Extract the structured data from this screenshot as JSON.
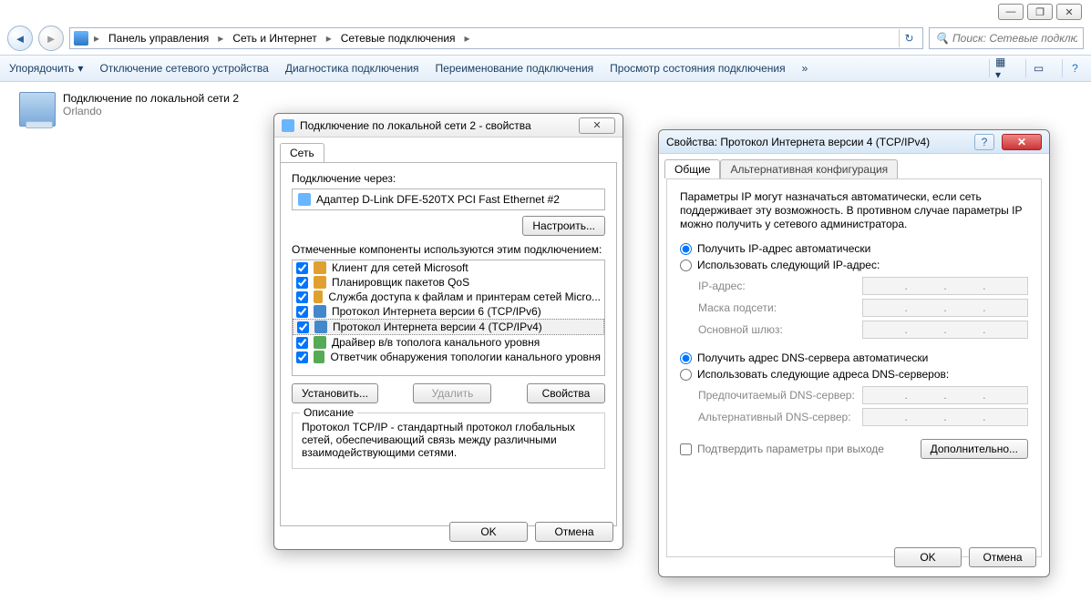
{
  "window": {
    "min_icon": "—",
    "max_icon": "❐",
    "close_icon": "✕"
  },
  "breadcrumb": {
    "items": [
      "Панель управления",
      "Сеть и Интернет",
      "Сетевые подключения"
    ],
    "search_placeholder": "Поиск: Сетевые подключ..."
  },
  "toolbar": {
    "organize": "Упорядочить",
    "disable": "Отключение сетевого устройства",
    "diagnose": "Диагностика подключения",
    "rename": "Переименование подключения",
    "status": "Просмотр состояния подключения"
  },
  "connection": {
    "name": "Подключение по локальной сети 2",
    "sub": "Orlando"
  },
  "dlg1": {
    "title": "Подключение по локальной сети 2 - свойства",
    "tab": "Сеть",
    "connect_via": "Подключение через:",
    "adapter": "Адаптер D-Link DFE-520TX PCI Fast Ethernet #2",
    "configure": "Настроить...",
    "components_label": "Отмеченные компоненты используются этим подключением:",
    "components": [
      "Клиент для сетей Microsoft",
      "Планировщик пакетов QoS",
      "Служба доступа к файлам и принтерам сетей Micro...",
      "Протокол Интернета версии 6 (TCP/IPv6)",
      "Протокол Интернета версии 4 (TCP/IPv4)",
      "Драйвер в/в тополога канального уровня",
      "Ответчик обнаружения топологии канального уровня"
    ],
    "install": "Установить...",
    "uninstall": "Удалить",
    "properties": "Свойства",
    "desc_title": "Описание",
    "desc_text": "Протокол TCP/IP - стандартный протокол глобальных сетей, обеспечивающий связь между различными взаимодействующими сетями.",
    "ok": "OK",
    "cancel": "Отмена"
  },
  "dlg2": {
    "title": "Свойства: Протокол Интернета версии 4 (TCP/IPv4)",
    "tab_general": "Общие",
    "tab_alt": "Альтернативная конфигурация",
    "intro": "Параметры IP могут назначаться автоматически, если сеть поддерживает эту возможность. В противном случае параметры IP можно получить у сетевого администратора.",
    "radio_auto_ip": "Получить IP-адрес автоматически",
    "radio_manual_ip": "Использовать следующий IP-адрес:",
    "ip_label": "IP-адрес:",
    "mask_label": "Маска подсети:",
    "gateway_label": "Основной шлюз:",
    "radio_auto_dns": "Получить адрес DNS-сервера автоматически",
    "radio_manual_dns": "Использовать следующие адреса DNS-серверов:",
    "dns1_label": "Предпочитаемый DNS-сервер:",
    "dns2_label": "Альтернативный DNS-сервер:",
    "confirm_exit": "Подтвердить параметры при выходе",
    "advanced": "Дополнительно...",
    "ok": "OK",
    "cancel": "Отмена"
  }
}
